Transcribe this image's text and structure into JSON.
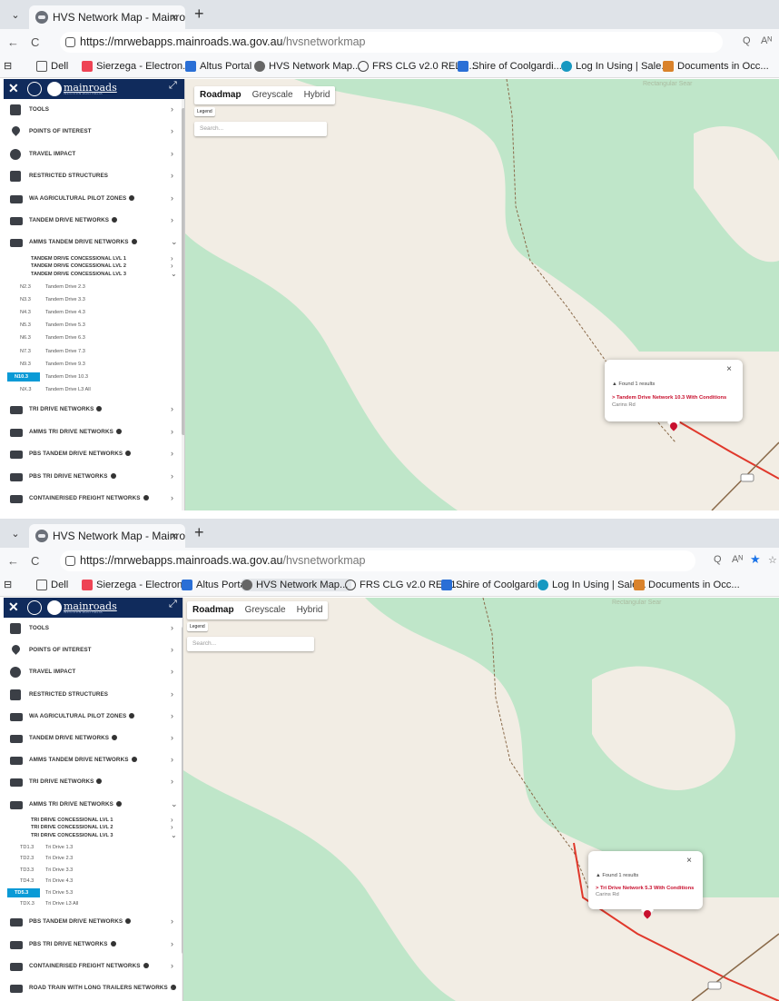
{
  "browser": {
    "tab_title": "HVS Network Map - Mainroads W/",
    "tab_close": "×",
    "new_tab": "+",
    "url_domain": "https://mrwebapps.mainroads.wa.gov.au",
    "url_path": "/hvsnetworkmap",
    "nav_back": "←",
    "nav_reload": "C",
    "zoom_icon": "Q",
    "read_icon": "Aᴺ",
    "bookmarks": [
      "Dell",
      "Sierzega - Electron...",
      "Altus Portal",
      "HVS Network Map...",
      "FRS CLG v2.0 REL 1...",
      "Shire of Coolgardi...",
      "Log In Using | Sale...",
      "Documents in Occ..."
    ]
  },
  "sidebar": {
    "brand": "mainroads",
    "brand_sub": "WESTERN AUSTRALIA"
  },
  "map_controls": {
    "map_types": [
      "Roadmap",
      "Greyscale",
      "Hybrid"
    ],
    "legend": "Legend",
    "search_placeholder": "Search...",
    "ghost_text": "Rectangular Sear"
  },
  "screen1": {
    "menu": [
      {
        "label": "TOOLS",
        "info": false,
        "chevron": "›"
      },
      {
        "label": "POINTS OF INTEREST",
        "info": false,
        "chevron": "›"
      },
      {
        "label": "TRAVEL IMPACT",
        "info": false,
        "chevron": "›"
      },
      {
        "label": "RESTRICTED STRUCTURES",
        "info": false,
        "chevron": "›"
      },
      {
        "label": "WA AGRICULTURAL PILOT ZONES",
        "info": true,
        "chevron": "›"
      },
      {
        "label": "TANDEM DRIVE NETWORKS",
        "info": true,
        "chevron": "›"
      },
      {
        "label": "AMMS TANDEM DRIVE NETWORKS",
        "info": true,
        "chevron": "⌄"
      }
    ],
    "submenu": [
      {
        "label": "TANDEM DRIVE CONCESSIONAL LVL 1",
        "chevron": "›"
      },
      {
        "label": "TANDEM DRIVE CONCESSIONAL LVL 2",
        "chevron": "›"
      },
      {
        "label": "TANDEM DRIVE CONCESSIONAL LVL 3",
        "chevron": "⌄"
      }
    ],
    "items": [
      {
        "code": "N2.3",
        "name": "Tandem Drive 2.3"
      },
      {
        "code": "N3.3",
        "name": "Tandem Drive 3.3"
      },
      {
        "code": "N4.3",
        "name": "Tandem Drive 4.3"
      },
      {
        "code": "N5.3",
        "name": "Tandem Drive 5.3"
      },
      {
        "code": "N6.3",
        "name": "Tandem Drive 6.3"
      },
      {
        "code": "N7.3",
        "name": "Tandem Drive 7.3"
      },
      {
        "code": "N9.3",
        "name": "Tandem Drive 9.3"
      },
      {
        "code": "N10.3",
        "name": "Tandem Drive 10.3",
        "active": true
      },
      {
        "code": "NX.3",
        "name": "Tandem Drive L3 All"
      }
    ],
    "menu_after": [
      {
        "label": "TRI DRIVE NETWORKS",
        "info": true,
        "chevron": "›"
      },
      {
        "label": "AMMS TRI DRIVE NETWORKS",
        "info": true,
        "chevron": "›"
      },
      {
        "label": "PBS TANDEM DRIVE NETWORKS",
        "info": true,
        "chevron": "›"
      },
      {
        "label": "PBS TRI DRIVE NETWORKS",
        "info": true,
        "chevron": "›"
      },
      {
        "label": "CONTAINERISED FREIGHT NETWORKS",
        "info": true,
        "chevron": "›"
      }
    ],
    "popup": {
      "close": "×",
      "found": "Found 1 results",
      "result": "> Tandem Drive Network 10.3 With Conditions",
      "road": "Carins Rd"
    }
  },
  "screen2": {
    "menu": [
      {
        "label": "TOOLS",
        "info": false,
        "chevron": "›"
      },
      {
        "label": "POINTS OF INTEREST",
        "info": false,
        "chevron": "›"
      },
      {
        "label": "TRAVEL IMPACT",
        "info": false,
        "chevron": "›"
      },
      {
        "label": "RESTRICTED STRUCTURES",
        "info": false,
        "chevron": "›"
      },
      {
        "label": "WA AGRICULTURAL PILOT ZONES",
        "info": true,
        "chevron": "›"
      },
      {
        "label": "TANDEM DRIVE NETWORKS",
        "info": true,
        "chevron": "›"
      },
      {
        "label": "AMMS TANDEM DRIVE NETWORKS",
        "info": true,
        "chevron": "›"
      },
      {
        "label": "TRI DRIVE NETWORKS",
        "info": true,
        "chevron": "›"
      },
      {
        "label": "AMMS TRI DRIVE NETWORKS",
        "info": true,
        "chevron": "⌄"
      }
    ],
    "submenu": [
      {
        "label": "TRI DRIVE CONCESSIONAL LVL 1",
        "chevron": "›"
      },
      {
        "label": "TRI DRIVE CONCESSIONAL LVL 2",
        "chevron": "›"
      },
      {
        "label": "TRI DRIVE CONCESSIONAL LVL 3",
        "chevron": "⌄"
      }
    ],
    "items": [
      {
        "code": "TD1.3",
        "name": "Tri Drive 1.3"
      },
      {
        "code": "TD2.3",
        "name": "Tri Drive 2.3"
      },
      {
        "code": "TD3.3",
        "name": "Tri Drive 3.3"
      },
      {
        "code": "TD4.3",
        "name": "Tri Drive 4.3"
      },
      {
        "code": "TD5.3",
        "name": "Tri Drive 5.3",
        "active": true
      },
      {
        "code": "TDX.3",
        "name": "Tri Drive L3 All"
      }
    ],
    "menu_after": [
      {
        "label": "PBS TANDEM DRIVE NETWORKS",
        "info": true,
        "chevron": "›"
      },
      {
        "label": "PBS TRI DRIVE NETWORKS",
        "info": true,
        "chevron": "›"
      },
      {
        "label": "CONTAINERISED FREIGHT NETWORKS",
        "info": true,
        "chevron": "›"
      },
      {
        "label": "ROAD TRAIN WITH LONG TRAILERS NETWORKS",
        "info": true,
        "chevron": "›"
      }
    ],
    "popup": {
      "close": "×",
      "found": "Found 1 results",
      "result": "> Tri Drive Network 5.3 With Conditions",
      "road": "Carins Rd"
    }
  },
  "colors": {
    "map_bg": "#f2ede4",
    "green": "#bfe6c9",
    "route": "#e0382b",
    "active": "#0a9ad6",
    "header": "#102b5c"
  }
}
